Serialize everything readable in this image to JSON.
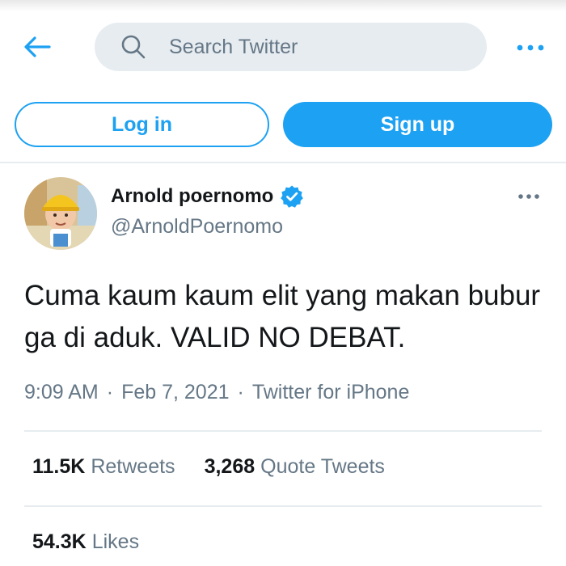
{
  "header": {
    "search_placeholder": "Search Twitter"
  },
  "auth": {
    "login_label": "Log in",
    "signup_label": "Sign up"
  },
  "tweet": {
    "display_name": "Arnold poernomo",
    "handle": "@ArnoldPoernomo",
    "text": "Cuma kaum kaum elit yang makan bubur ga di aduk. VALID NO DEBAT.",
    "time": "9:09 AM",
    "separator": "·",
    "date": "Feb 7, 2021",
    "source": "Twitter for iPhone"
  },
  "stats": {
    "retweets_count": "11.5K",
    "retweets_label": "Retweets",
    "quotes_count": "3,268",
    "quotes_label": "Quote Tweets",
    "likes_count": "54.3K",
    "likes_label": "Likes"
  },
  "icons": {
    "back": "arrow-left-icon",
    "search": "search-icon",
    "more": "more-horizontal-icon",
    "verified": "verified-badge-icon"
  },
  "colors": {
    "brand": "#1da1f2",
    "secondary_text": "#657786",
    "primary_text": "#14171a",
    "search_bg": "#e6ecf0"
  }
}
